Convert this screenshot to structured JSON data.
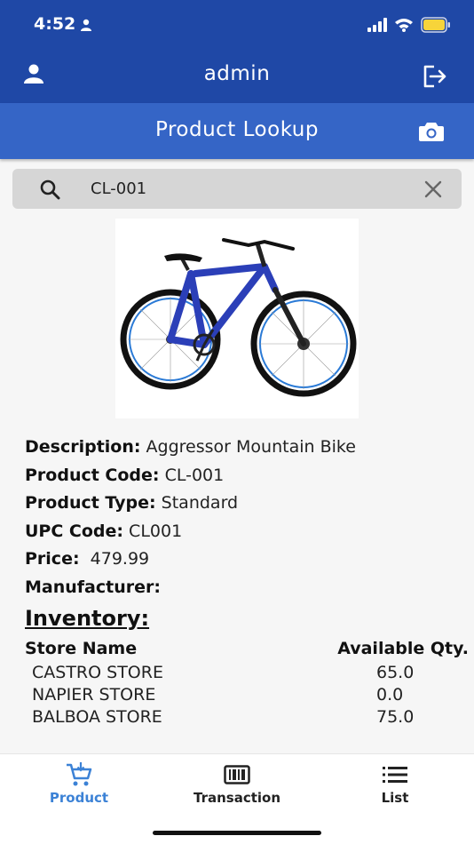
{
  "status_bar": {
    "time": "4:52"
  },
  "header": {
    "title": "admin"
  },
  "sub_header": {
    "title": "Product Lookup"
  },
  "search": {
    "value": "CL-001",
    "placeholder": ""
  },
  "product": {
    "description_label": "Description:",
    "description": "Aggressor Mountain Bike",
    "code_label": "Product Code:",
    "code": "CL-001",
    "type_label": "Product Type:",
    "type": "Standard",
    "upc_label": "UPC Code:",
    "upc": "CL001",
    "price_label": "Price:",
    "price": "479.99",
    "manufacturer_label": "Manufacturer:",
    "manufacturer": ""
  },
  "inventory": {
    "title": "Inventory:",
    "col_store": "Store Name",
    "col_qty": "Available Qty.",
    "rows": [
      {
        "store": "CASTRO STORE",
        "qty": "65.0"
      },
      {
        "store": "NAPIER STORE",
        "qty": "0.0"
      },
      {
        "store": "BALBOA STORE",
        "qty": "75.0"
      }
    ]
  },
  "nav": {
    "items": [
      {
        "label": "Product",
        "icon": "cart-icon"
      },
      {
        "label": "Transaction",
        "icon": "barcode-icon"
      },
      {
        "label": "List",
        "icon": "list-icon"
      }
    ],
    "active_color": "#3c82d6"
  },
  "colors": {
    "header": "#1f48a6",
    "sub_header": "#3565c6",
    "bike_frame": "#2b3fb8"
  }
}
